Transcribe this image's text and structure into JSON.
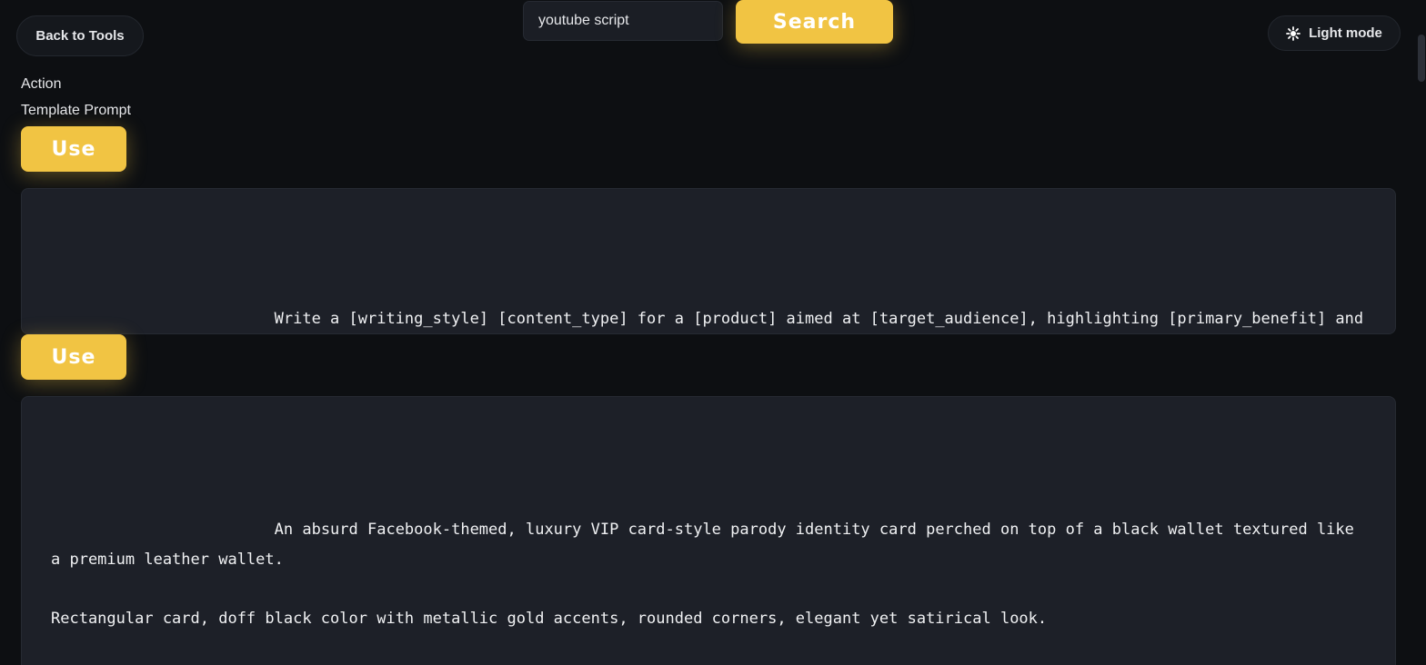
{
  "header": {
    "back_label": "Back to Tools",
    "search_value": "youtube script",
    "search_button_label": "Search",
    "theme_toggle_label": "Light mode",
    "theme_icon": "sun-icon"
  },
  "section": {
    "action_label": "Action",
    "template_label": "Template Prompt",
    "use_label": "Use"
  },
  "prompts": [
    {
      "text": "                        Write a [writing_style] [content_type] for a [product] aimed at [target_audience], highlighting [primary_benefit] and premium taste in an [mood]."
    },
    {
      "text": "                        An absurd Facebook-themed, luxury VIP card-style parody identity card perched on top of a black wallet textured like a premium leather wallet.\n\nRectangular card, doff black color with metallic gold accents, rounded corners, elegant yet satirical look.\n\nAt the top is written big and firm:"
    }
  ],
  "colors": {
    "background": "#0d0f12",
    "card": "#1d2028",
    "accent": "#f1c443"
  }
}
